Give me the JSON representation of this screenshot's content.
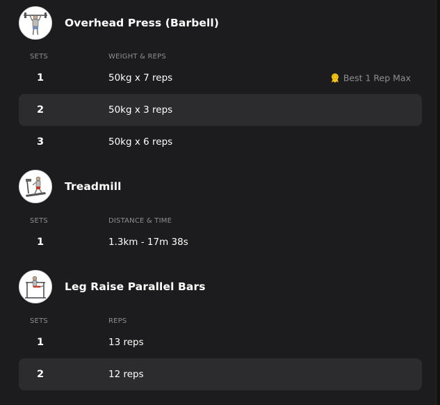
{
  "exercises": [
    {
      "title": "Overhead Press (Barbell)",
      "col_sets": "SETS",
      "col_metric": "WEIGHT & REPS",
      "sets": [
        {
          "num": "1",
          "value": "50kg x 7 reps",
          "badge": "Best 1 Rep Max"
        },
        {
          "num": "2",
          "value": "50kg x 3 reps"
        },
        {
          "num": "3",
          "value": "50kg x 6 reps"
        }
      ]
    },
    {
      "title": "Treadmill",
      "col_sets": "SETS",
      "col_metric": "DISTANCE & TIME",
      "sets": [
        {
          "num": "1",
          "value": "1.3km - 17m 38s"
        }
      ]
    },
    {
      "title": "Leg Raise Parallel Bars",
      "col_sets": "SETS",
      "col_metric": "REPS",
      "sets": [
        {
          "num": "1",
          "value": "13 reps"
        },
        {
          "num": "2",
          "value": "12 reps"
        }
      ]
    }
  ],
  "icons": {
    "ex0": "overhead-press-figure-icon",
    "ex1": "treadmill-figure-icon",
    "ex2": "leg-raise-figure-icon",
    "badge": "medal-icon"
  },
  "colors": {
    "background": "#1c1c1e",
    "row_highlight": "#2c2c2e",
    "muted_text": "#8e8e93",
    "medal": "#f5c518"
  }
}
